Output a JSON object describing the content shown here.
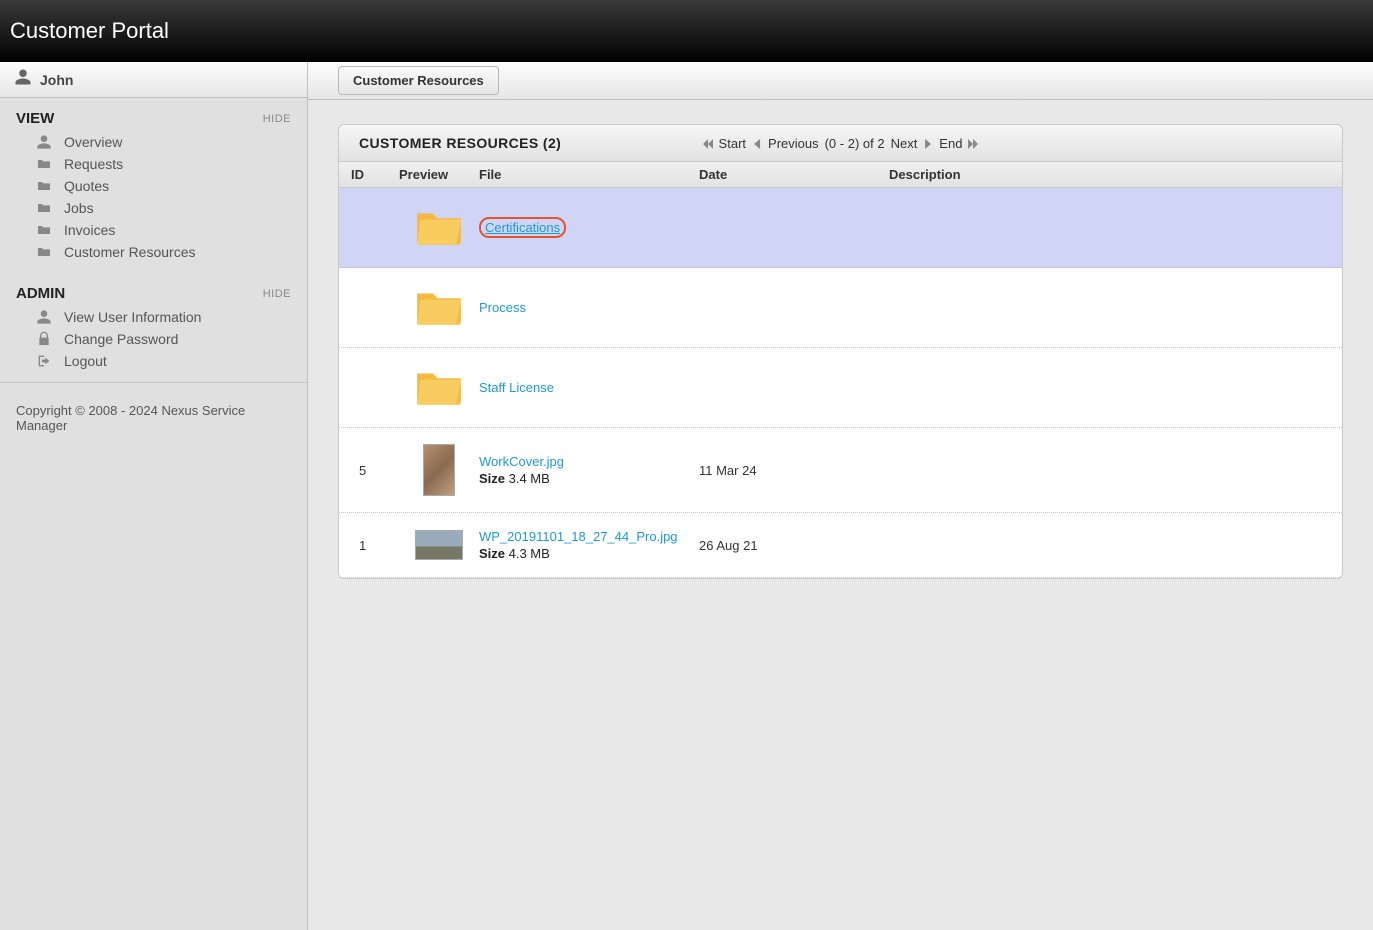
{
  "header": {
    "title": "Customer Portal"
  },
  "user": {
    "name": "John"
  },
  "sidebar": {
    "view": {
      "title": "VIEW",
      "hide_label": "HIDE",
      "items": [
        {
          "label": "Overview",
          "icon": "user"
        },
        {
          "label": "Requests",
          "icon": "folder"
        },
        {
          "label": "Quotes",
          "icon": "folder"
        },
        {
          "label": "Jobs",
          "icon": "folder"
        },
        {
          "label": "Invoices",
          "icon": "folder"
        },
        {
          "label": "Customer Resources",
          "icon": "folder"
        }
      ]
    },
    "admin": {
      "title": "ADMIN",
      "hide_label": "HIDE",
      "items": [
        {
          "label": "View User Information",
          "icon": "user"
        },
        {
          "label": "Change Password",
          "icon": "lock"
        },
        {
          "label": "Logout",
          "icon": "arrow-out"
        }
      ]
    },
    "copyright": "Copyright © 2008 - 2024 Nexus Service Manager"
  },
  "tabs": {
    "active": "Customer Resources"
  },
  "panel": {
    "title": "CUSTOMER RESOURCES (2)",
    "pager": {
      "start": "Start",
      "previous": "Previous",
      "range": "(0 - 2) of 2",
      "next": "Next",
      "end": "End"
    },
    "columns": {
      "id": "ID",
      "preview": "Preview",
      "file": "File",
      "date": "Date",
      "description": "Description"
    }
  },
  "rows": [
    {
      "id": "",
      "type": "folder",
      "file": "Certifications",
      "selected": true,
      "date": "",
      "size": ""
    },
    {
      "id": "",
      "type": "folder",
      "file": "Process",
      "selected": false,
      "date": "",
      "size": ""
    },
    {
      "id": "",
      "type": "folder",
      "file": "Staff License",
      "selected": false,
      "date": "",
      "size": ""
    },
    {
      "id": "5",
      "type": "image",
      "file": "WorkCover.jpg",
      "selected": false,
      "date": "11 Mar 24",
      "size": "3.4 MB",
      "size_label": "Size"
    },
    {
      "id": "1",
      "type": "image-wide",
      "file": "WP_20191101_18_27_44_Pro.jpg",
      "selected": false,
      "date": "26 Aug 21",
      "size": "4.3 MB",
      "size_label": "Size"
    }
  ]
}
